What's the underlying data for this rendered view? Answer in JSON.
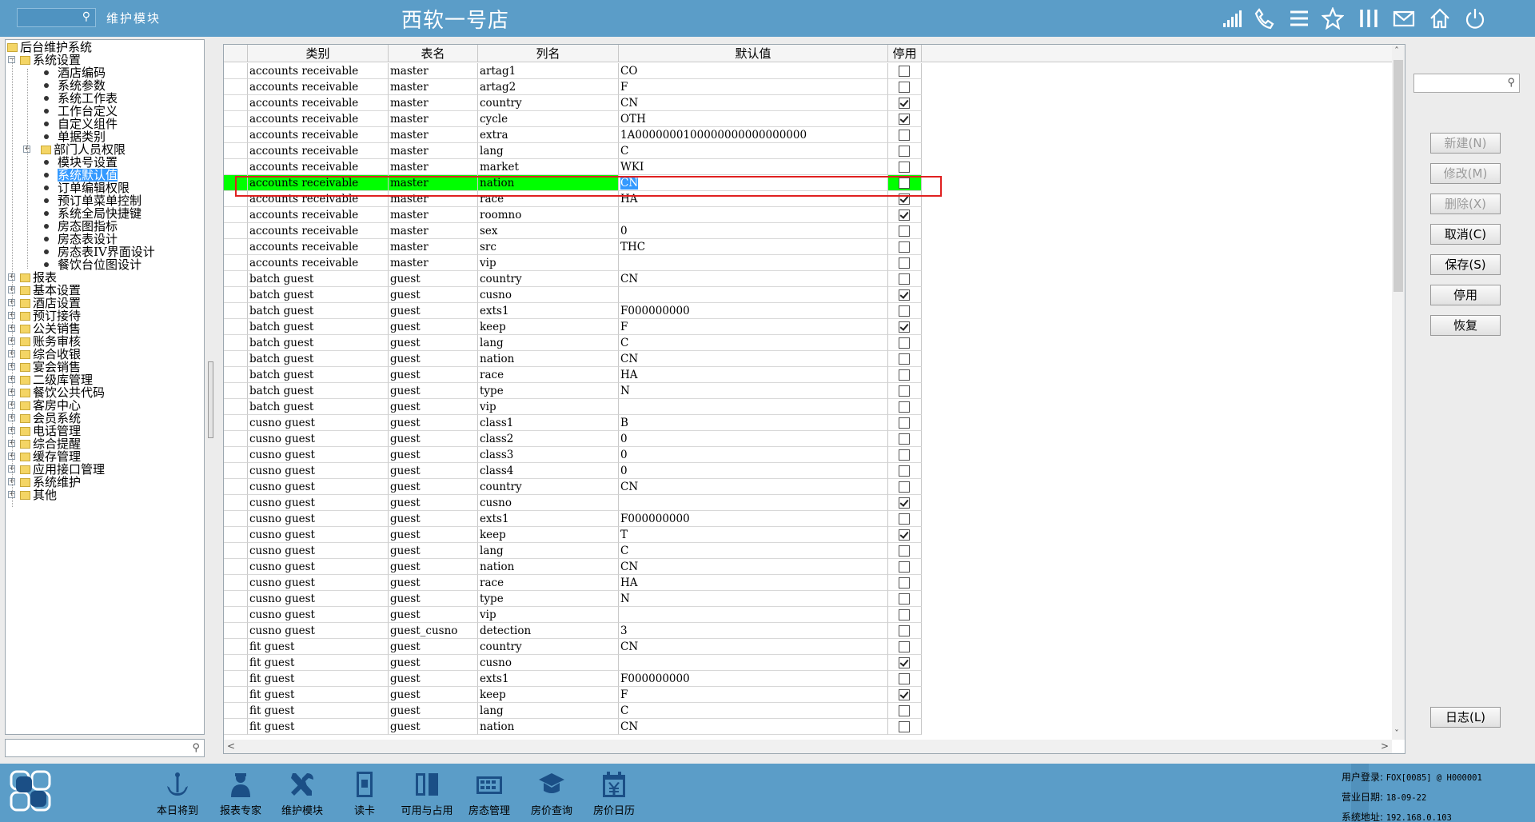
{
  "topbar": {
    "search_placeholder": "",
    "module_label": "维护模块",
    "store_title": "西软一号店",
    "icons": [
      "signal-icon",
      "phone-icon",
      "menu-icon",
      "star-icon",
      "columns-icon",
      "mail-icon",
      "home-icon",
      "power-icon"
    ]
  },
  "tree": {
    "nodes": [
      {
        "label": "后台维护系统",
        "level": 0,
        "kind": "folder",
        "expander": "",
        "selected": false
      },
      {
        "label": "系统设置",
        "level": 1,
        "kind": "folder",
        "expander": "-",
        "selected": false
      },
      {
        "label": "酒店编码",
        "level": 2,
        "kind": "leaf",
        "expander": "",
        "selected": false
      },
      {
        "label": "系统参数",
        "level": 2,
        "kind": "leaf",
        "expander": "",
        "selected": false
      },
      {
        "label": "系统工作表",
        "level": 2,
        "kind": "leaf",
        "expander": "",
        "selected": false
      },
      {
        "label": "工作台定义",
        "level": 2,
        "kind": "leaf",
        "expander": "",
        "selected": false
      },
      {
        "label": "自定义组件",
        "level": 2,
        "kind": "leaf",
        "expander": "",
        "selected": false
      },
      {
        "label": "单据类别",
        "level": 2,
        "kind": "leaf",
        "expander": "",
        "selected": false
      },
      {
        "label": "部门人员权限",
        "level": 2,
        "kind": "folder",
        "expander": "+",
        "selected": false
      },
      {
        "label": "模块号设置",
        "level": 2,
        "kind": "leaf",
        "expander": "",
        "selected": false
      },
      {
        "label": "系统默认值",
        "level": 2,
        "kind": "leaf",
        "expander": "",
        "selected": true
      },
      {
        "label": "订单编辑权限",
        "level": 2,
        "kind": "leaf",
        "expander": "",
        "selected": false
      },
      {
        "label": "预订单菜单控制",
        "level": 2,
        "kind": "leaf",
        "expander": "",
        "selected": false
      },
      {
        "label": "系统全局快捷键",
        "level": 2,
        "kind": "leaf",
        "expander": "",
        "selected": false
      },
      {
        "label": "房态图指标",
        "level": 2,
        "kind": "leaf",
        "expander": "",
        "selected": false
      },
      {
        "label": "房态表设计",
        "level": 2,
        "kind": "leaf",
        "expander": "",
        "selected": false
      },
      {
        "label": "房态表IV界面设计",
        "level": 2,
        "kind": "leaf",
        "expander": "",
        "selected": false
      },
      {
        "label": "餐饮台位图设计",
        "level": 2,
        "kind": "leaf",
        "expander": "",
        "selected": false
      },
      {
        "label": "报表",
        "level": 1,
        "kind": "folder",
        "expander": "+",
        "selected": false
      },
      {
        "label": "基本设置",
        "level": 1,
        "kind": "folder",
        "expander": "+",
        "selected": false
      },
      {
        "label": "酒店设置",
        "level": 1,
        "kind": "folder",
        "expander": "+",
        "selected": false
      },
      {
        "label": "预订接待",
        "level": 1,
        "kind": "folder",
        "expander": "+",
        "selected": false
      },
      {
        "label": "公关销售",
        "level": 1,
        "kind": "folder",
        "expander": "+",
        "selected": false
      },
      {
        "label": "账务审核",
        "level": 1,
        "kind": "folder",
        "expander": "+",
        "selected": false
      },
      {
        "label": "综合收银",
        "level": 1,
        "kind": "folder",
        "expander": "+",
        "selected": false
      },
      {
        "label": "宴会销售",
        "level": 1,
        "kind": "folder",
        "expander": "+",
        "selected": false
      },
      {
        "label": "二级库管理",
        "level": 1,
        "kind": "folder",
        "expander": "+",
        "selected": false
      },
      {
        "label": "餐饮公共代码",
        "level": 1,
        "kind": "folder",
        "expander": "+",
        "selected": false
      },
      {
        "label": "客房中心",
        "level": 1,
        "kind": "folder",
        "expander": "+",
        "selected": false
      },
      {
        "label": "会员系统",
        "level": 1,
        "kind": "folder",
        "expander": "+",
        "selected": false
      },
      {
        "label": "电话管理",
        "level": 1,
        "kind": "folder",
        "expander": "+",
        "selected": false
      },
      {
        "label": "综合提醒",
        "level": 1,
        "kind": "folder",
        "expander": "+",
        "selected": false
      },
      {
        "label": "缓存管理",
        "level": 1,
        "kind": "folder",
        "expander": "+",
        "selected": false
      },
      {
        "label": "应用接口管理",
        "level": 1,
        "kind": "folder",
        "expander": "+",
        "selected": false
      },
      {
        "label": "系统维护",
        "level": 1,
        "kind": "folder",
        "expander": "+",
        "selected": false
      },
      {
        "label": "其他",
        "level": 1,
        "kind": "folder",
        "expander": "+",
        "selected": false
      }
    ],
    "search_value": ""
  },
  "grid": {
    "columns": [
      "类别",
      "表名",
      "列名",
      "默认值",
      "停用"
    ],
    "highlight_row": 7,
    "rows": [
      [
        "accounts receivable",
        "master",
        "artag1",
        "CO",
        false
      ],
      [
        "accounts receivable",
        "master",
        "artag2",
        "F",
        false
      ],
      [
        "accounts receivable",
        "master",
        "country",
        "CN",
        true
      ],
      [
        "accounts receivable",
        "master",
        "cycle",
        "OTH",
        true
      ],
      [
        "accounts receivable",
        "master",
        "extra",
        "1A0000000100000000000000000",
        false
      ],
      [
        "accounts receivable",
        "master",
        "lang",
        "C",
        false
      ],
      [
        "accounts receivable",
        "master",
        "market",
        "WKI",
        false
      ],
      [
        "accounts receivable",
        "master",
        "nation",
        "CN",
        false
      ],
      [
        "accounts receivable",
        "master",
        "race",
        "HA",
        true
      ],
      [
        "accounts receivable",
        "master",
        "roomno",
        "",
        true
      ],
      [
        "accounts receivable",
        "master",
        "sex",
        "0",
        false
      ],
      [
        "accounts receivable",
        "master",
        "src",
        "THC",
        false
      ],
      [
        "accounts receivable",
        "master",
        "vip",
        "",
        false
      ],
      [
        "batch guest",
        "guest",
        "country",
        "CN",
        false
      ],
      [
        "batch guest",
        "guest",
        "cusno",
        "",
        true
      ],
      [
        "batch guest",
        "guest",
        "exts1",
        "F000000000",
        false
      ],
      [
        "batch guest",
        "guest",
        "keep",
        "F",
        true
      ],
      [
        "batch guest",
        "guest",
        "lang",
        "C",
        false
      ],
      [
        "batch guest",
        "guest",
        "nation",
        "CN",
        false
      ],
      [
        "batch guest",
        "guest",
        "race",
        "HA",
        false
      ],
      [
        "batch guest",
        "guest",
        "type",
        "N",
        false
      ],
      [
        "batch guest",
        "guest",
        "vip",
        "",
        false
      ],
      [
        "cusno guest",
        "guest",
        "class1",
        "B",
        false
      ],
      [
        "cusno guest",
        "guest",
        "class2",
        "0",
        false
      ],
      [
        "cusno guest",
        "guest",
        "class3",
        "0",
        false
      ],
      [
        "cusno guest",
        "guest",
        "class4",
        "0",
        false
      ],
      [
        "cusno guest",
        "guest",
        "country",
        "CN",
        false
      ],
      [
        "cusno guest",
        "guest",
        "cusno",
        "",
        true
      ],
      [
        "cusno guest",
        "guest",
        "exts1",
        "F000000000",
        false
      ],
      [
        "cusno guest",
        "guest",
        "keep",
        "T",
        true
      ],
      [
        "cusno guest",
        "guest",
        "lang",
        "C",
        false
      ],
      [
        "cusno guest",
        "guest",
        "nation",
        "CN",
        false
      ],
      [
        "cusno guest",
        "guest",
        "race",
        "HA",
        false
      ],
      [
        "cusno guest",
        "guest",
        "type",
        "N",
        false
      ],
      [
        "cusno guest",
        "guest",
        "vip",
        "",
        false
      ],
      [
        "cusno guest",
        "guest_cusno",
        "detection",
        "3",
        false
      ],
      [
        "fit guest",
        "guest",
        "country",
        "CN",
        false
      ],
      [
        "fit guest",
        "guest",
        "cusno",
        "",
        true
      ],
      [
        "fit guest",
        "guest",
        "exts1",
        "F000000000",
        false
      ],
      [
        "fit guest",
        "guest",
        "keep",
        "F",
        true
      ],
      [
        "fit guest",
        "guest",
        "lang",
        "C",
        false
      ],
      [
        "fit guest",
        "guest",
        "nation",
        "CN",
        false
      ]
    ]
  },
  "right_panel": {
    "search_value": "",
    "buttons": [
      {
        "label": "新建(N)",
        "enabled": false
      },
      {
        "label": "修改(M)",
        "enabled": false
      },
      {
        "label": "删除(X)",
        "enabled": false
      },
      {
        "label": "取消(C)",
        "enabled": true
      },
      {
        "label": "保存(S)",
        "enabled": true
      },
      {
        "label": "停用",
        "enabled": true
      },
      {
        "label": "恢复",
        "enabled": true
      }
    ],
    "log_button": "日志(L)"
  },
  "taskbar": {
    "items": [
      {
        "label": "本日将到",
        "icon": "anchor-icon"
      },
      {
        "label": "报表专家",
        "icon": "person-icon"
      },
      {
        "label": "维护模块",
        "icon": "tools-icon"
      },
      {
        "label": "读卡",
        "icon": "card-icon"
      },
      {
        "label": "可用与占用",
        "icon": "door-icon"
      },
      {
        "label": "房态管理",
        "icon": "grid-icon"
      },
      {
        "label": "房价查询",
        "icon": "hat-icon"
      },
      {
        "label": "房价日历",
        "icon": "calendar-icon"
      }
    ]
  },
  "status": {
    "user_label": "用户登录:",
    "user_value": "FOX[0085] @ H000001",
    "date_label": "营业日期:",
    "date_value": "18-09-22",
    "addr_label": "系统地址:",
    "addr_value": "192.168.0.103"
  }
}
